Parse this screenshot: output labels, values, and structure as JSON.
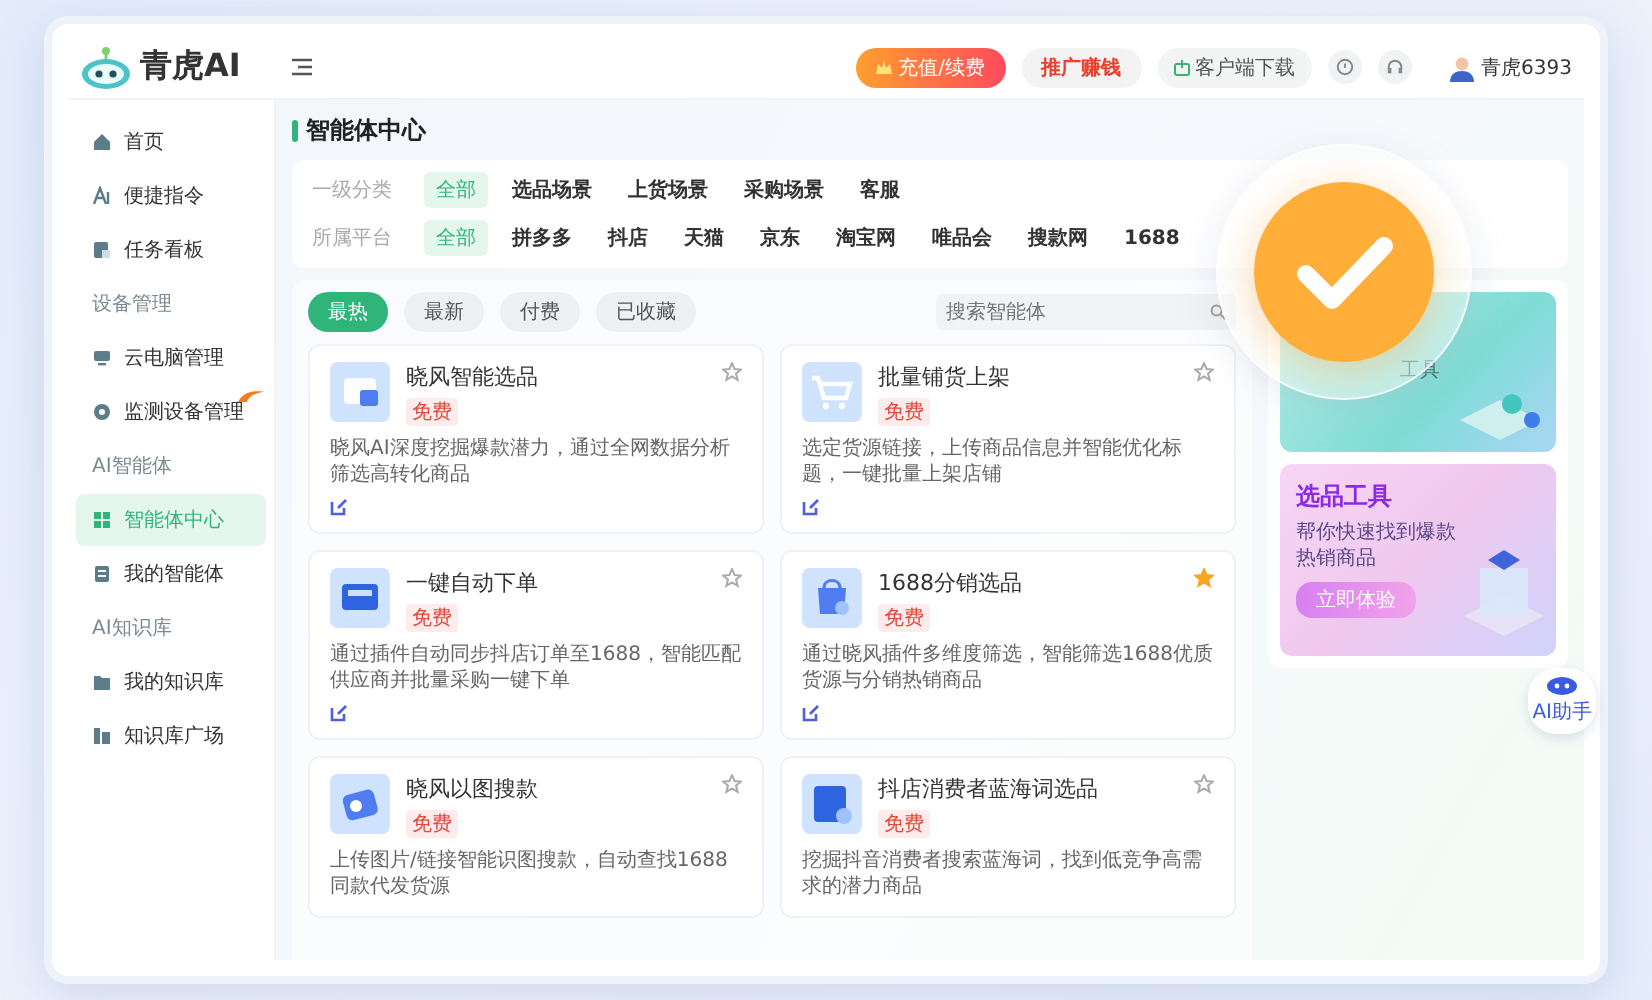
{
  "app": {
    "name": "青虎AI"
  },
  "topbar": {
    "recharge": "充值/续费",
    "promote": "推广赚钱",
    "download": "客户端下载",
    "user": "青虎6393"
  },
  "sidebar": {
    "items": [
      {
        "kind": "item",
        "label": "首页",
        "selected": false,
        "hot": false
      },
      {
        "kind": "item",
        "label": "便捷指令",
        "selected": false,
        "hot": false
      },
      {
        "kind": "item",
        "label": "任务看板",
        "selected": false,
        "hot": false
      },
      {
        "kind": "section",
        "label": "设备管理"
      },
      {
        "kind": "item",
        "label": "云电脑管理",
        "selected": false,
        "hot": false
      },
      {
        "kind": "item",
        "label": "监测设备管理",
        "selected": false,
        "hot": true
      },
      {
        "kind": "section",
        "label": "AI智能体"
      },
      {
        "kind": "item",
        "label": "智能体中心",
        "selected": true,
        "hot": false
      },
      {
        "kind": "item",
        "label": "我的智能体",
        "selected": false,
        "hot": false
      },
      {
        "kind": "section",
        "label": "AI知识库"
      },
      {
        "kind": "item",
        "label": "我的知识库",
        "selected": false,
        "hot": false
      },
      {
        "kind": "item",
        "label": "知识库广场",
        "selected": false,
        "hot": false
      }
    ]
  },
  "page": {
    "title": "智能体中心"
  },
  "filters": [
    {
      "label": "一级分类",
      "options": [
        {
          "label": "全部",
          "selected": true
        },
        {
          "label": "选品场景",
          "selected": false
        },
        {
          "label": "上货场景",
          "selected": false
        },
        {
          "label": "采购场景",
          "selected": false
        },
        {
          "label": "客服",
          "selected": false
        }
      ]
    },
    {
      "label": "所属平台",
      "options": [
        {
          "label": "全部",
          "selected": true
        },
        {
          "label": "拼多多",
          "selected": false
        },
        {
          "label": "抖店",
          "selected": false
        },
        {
          "label": "天猫",
          "selected": false
        },
        {
          "label": "京东",
          "selected": false
        },
        {
          "label": "淘宝网",
          "selected": false
        },
        {
          "label": "唯品会",
          "selected": false
        },
        {
          "label": "搜款网",
          "selected": false
        },
        {
          "label": "1688",
          "selected": false
        }
      ]
    }
  ],
  "sort_tabs": [
    {
      "label": "最热",
      "selected": true
    },
    {
      "label": "最新",
      "selected": false
    },
    {
      "label": "付费",
      "selected": false
    },
    {
      "label": "已收藏",
      "selected": false
    }
  ],
  "search": {
    "placeholder": "搜索智能体"
  },
  "agents": [
    {
      "title": "晓风智能选品",
      "tag": "免费",
      "description": "晓风AI深度挖掘爆款潜力，通过全网数据分析筛选高转化商品",
      "starred": false,
      "edit_icon": true
    },
    {
      "title": "批量铺货上架",
      "tag": "免费",
      "description": "选定货源链接，上传商品信息并智能优化标题，一键批量上架店铺",
      "starred": false,
      "edit_icon": true
    },
    {
      "title": "一键自动下单",
      "tag": "免费",
      "description": "通过插件自动同步抖店订单至1688，智能匹配供应商并批量采购一键下单",
      "starred": false,
      "edit_icon": true
    },
    {
      "title": "1688分销选品",
      "tag": "免费",
      "description": "通过晓风插件多维度筛选，智能筛选1688优质货源与分销热销商品",
      "starred": true,
      "edit_icon": true
    },
    {
      "title": "晓风以图搜款",
      "tag": "免费",
      "description": "上传图片/链接智能识图搜款，自动查找1688同款代发货源",
      "starred": false,
      "edit_icon": false
    },
    {
      "title": "抖店消费者蓝海词选品",
      "tag": "免费",
      "description": "挖掘抖音消费者搜索蓝海词，找到低竞争高需求的潜力商品",
      "starred": false,
      "edit_icon": false
    }
  ],
  "banners": [
    {
      "kind": "teal",
      "title": "工具"
    },
    {
      "kind": "pink",
      "title": "选品工具",
      "subtitle": "帮你快速找到爆款热销商品",
      "button": "立即体验"
    }
  ],
  "assistant": {
    "label": "AI助手"
  }
}
